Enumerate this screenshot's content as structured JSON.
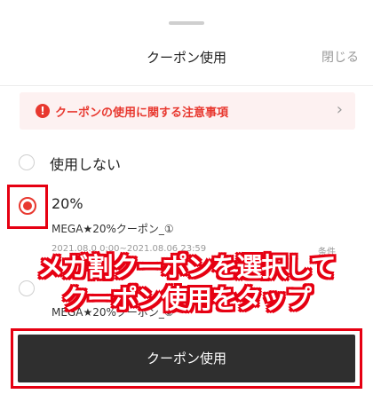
{
  "header": {
    "title": "クーポン使用",
    "close_label": "閉じる"
  },
  "notice": {
    "icon_glyph": "!",
    "text": "クーポンの使用に関する注意事項",
    "chevron": "›"
  },
  "options": {
    "none_label": "使用しない",
    "coupon1": {
      "label": "20%",
      "name": "MEGA★20%クーポン_①",
      "meta_left": "2021.08.0 0:00~2021.08.06 23:59",
      "meta_right": "条件"
    },
    "coupon2": {
      "name": "MEGA★20%クーポン_②"
    }
  },
  "annotation": {
    "line1": "メガ割クーポンを選択して",
    "line2": "クーポン使用をタップ"
  },
  "footer": {
    "use_button_label": "クーポン使用"
  },
  "colors": {
    "accent": "#e8382f",
    "annotation_red": "#e60012",
    "button_bg": "#2f2f2f"
  }
}
